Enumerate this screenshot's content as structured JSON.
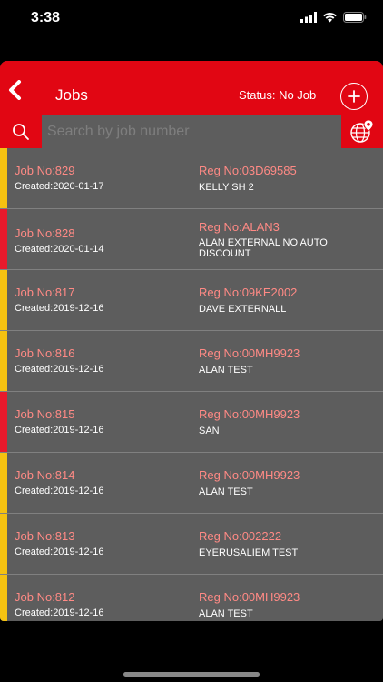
{
  "status_bar": {
    "time": "3:38"
  },
  "header": {
    "title": "Jobs",
    "status_text": "Status: No Job"
  },
  "search": {
    "placeholder": "Search by job number"
  },
  "colors": {
    "primary_red": "#e10613",
    "accent_pink": "#ff8a85",
    "bar_yellow": "#f5c211",
    "bar_red": "#e8192c"
  },
  "jobs": [
    {
      "job": "Job No:829",
      "created": "Created:2020-01-17",
      "reg": "Reg No:03D69585",
      "customer": "KELLY SH 2",
      "bar": "#f5c211"
    },
    {
      "job": "Job No:828",
      "created": "Created:2020-01-14",
      "reg": "Reg No:ALAN3",
      "customer": "ALAN EXTERNAL NO AUTO DISCOUNT",
      "bar": "#e8192c"
    },
    {
      "job": "Job No:817",
      "created": "Created:2019-12-16",
      "reg": "Reg No:09KE2002",
      "customer": "DAVE EXTERNALL",
      "bar": "#f5c211"
    },
    {
      "job": "Job No:816",
      "created": "Created:2019-12-16",
      "reg": "Reg No:00MH9923",
      "customer": "ALAN TEST",
      "bar": "#f5c211"
    },
    {
      "job": "Job No:815",
      "created": "Created:2019-12-16",
      "reg": "Reg No:00MH9923",
      "customer": "SAN",
      "bar": "#e8192c"
    },
    {
      "job": "Job No:814",
      "created": "Created:2019-12-16",
      "reg": "Reg No:00MH9923",
      "customer": "ALAN TEST",
      "bar": "#f5c211"
    },
    {
      "job": "Job No:813",
      "created": "Created:2019-12-16",
      "reg": "Reg No:002222",
      "customer": "EYERUSALIEM TEST",
      "bar": "#f5c211"
    },
    {
      "job": "Job No:812",
      "created": "Created:2019-12-16",
      "reg": "Reg No:00MH9923",
      "customer": "ALAN TEST",
      "bar": "#f5c211"
    }
  ]
}
